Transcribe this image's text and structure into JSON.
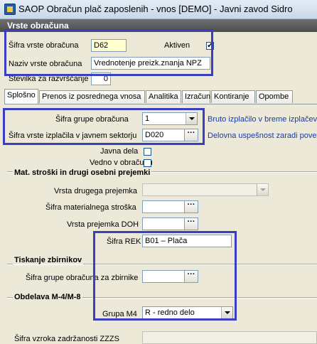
{
  "window": {
    "title": "SAOP Obračun plač zaposlenih - vnos [DEMO] - Javni zavod Sidro"
  },
  "group_header": "Vrste obračuna",
  "header_fields": {
    "sifra_label": "Šifra vrste obračuna",
    "sifra_value": "D62",
    "aktiven_label": "Aktiven",
    "aktiven_checked": true,
    "naziv_label": "Naziv vrste obračuna",
    "naziv_value": "Vrednotenje preizk.znanja NPZ",
    "stevilka_label": "Številka  za razvrščanje",
    "stevilka_value": "0"
  },
  "tabs": [
    "Splošno",
    "Prenos iz posrednega vnosa",
    "Analitika",
    "Izračun",
    "Kontiranje",
    "Opombe"
  ],
  "general": {
    "sifra_grupe_label": "Šifra grupe obračuna",
    "sifra_grupe_value": "1",
    "sifra_grupe_desc": "Bruto izplačilo v breme izplačeva",
    "sifra_izplacila_label": "Šifra vrste izplačila v javnem sektorju",
    "sifra_izplacila_value": "D020",
    "sifra_izplacila_desc": "Delovna uspešnost zaradi poveč",
    "javna_dela_label": "Javna dela",
    "vedno_label": "Vedno v obračunu"
  },
  "mat_section": {
    "title": "Mat. stroški in drugi osebni prejemki",
    "vrsta_drugega_label": "Vrsta drugega prejemka",
    "sifra_materialnega_label": "Šifra materialnega stroška",
    "vrsta_prejemka_doh_label": "Vrsta prejemka DOH",
    "sifra_rek_label": "Šifra REK",
    "sifra_rek_value": "B01 – Plača"
  },
  "tisk_section": {
    "title": "Tiskanje zbirnikov",
    "sifra_grupe_zbirnike_label": "Šifra grupe obračuna za zbirnike"
  },
  "m4_section": {
    "title": "Obdelava M-4/M-8",
    "grupa_label": "Grupa M4",
    "grupa_value": "R - redno delo"
  },
  "bottom": {
    "zzzs_label": "Šifra vzroka zadržanosti ZZZS"
  },
  "icons": {
    "dots": "···"
  }
}
